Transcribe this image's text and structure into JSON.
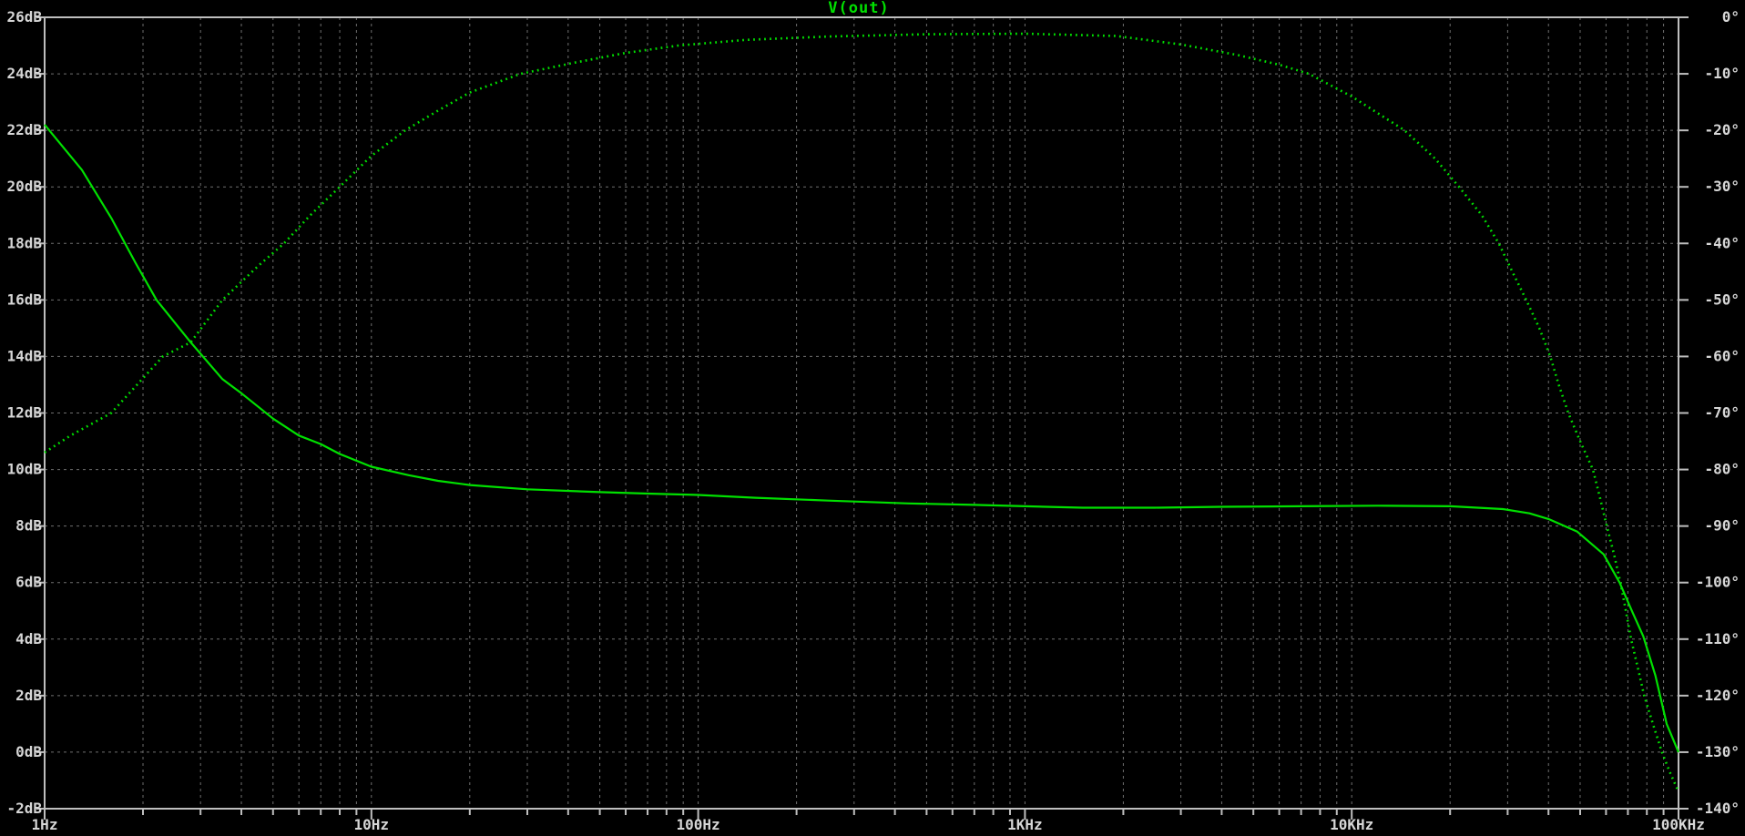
{
  "window": {
    "background": "#000000"
  },
  "chart_data": {
    "type": "line",
    "title": "V(out)",
    "title_color": "#00e000",
    "trace_color": "#00e000",
    "grid_color": "#6f6f6f",
    "axis_color": "#bebebe",
    "text_color": "#d6d6d6",
    "x_axis": {
      "scale": "log",
      "min_hz": 1,
      "max_hz": 100000,
      "tick_labels": [
        "1Hz",
        "10Hz",
        "100Hz",
        "1KHz",
        "10KHz",
        "100KHz"
      ]
    },
    "y_left_axis": {
      "unit": "dB",
      "max": 26,
      "min": -2,
      "step": 2,
      "tick_labels": [
        "26dB",
        "24dB",
        "22dB",
        "20dB",
        "18dB",
        "16dB",
        "14dB",
        "12dB",
        "10dB",
        "8dB",
        "6dB",
        "4dB",
        "2dB",
        "0dB",
        "-2dB"
      ]
    },
    "y_right_axis": {
      "unit": "deg",
      "max": 0,
      "min": -140,
      "step": 10,
      "tick_labels": [
        "0°",
        "-10°",
        "-20°",
        "-30°",
        "-40°",
        "-50°",
        "-60°",
        "-70°",
        "-80°",
        "-90°",
        "-100°",
        "-110°",
        "-120°",
        "-130°",
        "-140°"
      ]
    },
    "legend_position": "top-center-title-only",
    "grid": "on",
    "series": [
      {
        "name": "V(out) magnitude",
        "style": "solid",
        "axis": "left",
        "unit": "dB",
        "points": [
          [
            1,
            22.2
          ],
          [
            1.3,
            20.6
          ],
          [
            1.6,
            18.9
          ],
          [
            1.9,
            17.3
          ],
          [
            2.2,
            16.0
          ],
          [
            2.8,
            14.5
          ],
          [
            3.5,
            13.2
          ],
          [
            4,
            12.7
          ],
          [
            5,
            11.8
          ],
          [
            6,
            11.2
          ],
          [
            7,
            10.9
          ],
          [
            8,
            10.55
          ],
          [
            10,
            10.1
          ],
          [
            13,
            9.8
          ],
          [
            16,
            9.6
          ],
          [
            20,
            9.45
          ],
          [
            30,
            9.3
          ],
          [
            50,
            9.2
          ],
          [
            70,
            9.15
          ],
          [
            100,
            9.1
          ],
          [
            150,
            9.0
          ],
          [
            250,
            8.9
          ],
          [
            440,
            8.8
          ],
          [
            700,
            8.75
          ],
          [
            1000,
            8.7
          ],
          [
            1500,
            8.65
          ],
          [
            2500,
            8.65
          ],
          [
            4000,
            8.68
          ],
          [
            7000,
            8.7
          ],
          [
            12000,
            8.72
          ],
          [
            20000,
            8.7
          ],
          [
            29000,
            8.6
          ],
          [
            35000,
            8.45
          ],
          [
            40000,
            8.25
          ],
          [
            49000,
            7.8
          ],
          [
            59000,
            7.0
          ],
          [
            66000,
            6.0
          ],
          [
            72000,
            5.0
          ],
          [
            78000,
            4.1
          ],
          [
            85000,
            2.7
          ],
          [
            92000,
            1.0
          ],
          [
            100000,
            0.0
          ]
        ]
      },
      {
        "name": "V(out) phase",
        "style": "dotted",
        "axis": "right",
        "unit": "deg",
        "points": [
          [
            1,
            -77
          ],
          [
            1.2,
            -74
          ],
          [
            1.6,
            -70
          ],
          [
            2.3,
            -60
          ],
          [
            2.8,
            -57.5
          ],
          [
            3.5,
            -50
          ],
          [
            4.5,
            -44
          ],
          [
            5.4,
            -40
          ],
          [
            6.5,
            -35
          ],
          [
            8,
            -30
          ],
          [
            10,
            -24.5
          ],
          [
            12.7,
            -20
          ],
          [
            16,
            -16.5
          ],
          [
            20,
            -13.3
          ],
          [
            28.6,
            -10
          ],
          [
            42,
            -8
          ],
          [
            60,
            -6.3
          ],
          [
            87,
            -5
          ],
          [
            140,
            -4
          ],
          [
            250,
            -3.4
          ],
          [
            500,
            -3.0
          ],
          [
            1000,
            -2.9
          ],
          [
            1900,
            -3.3
          ],
          [
            3000,
            -4.8
          ],
          [
            4500,
            -6.7
          ],
          [
            6000,
            -8.4
          ],
          [
            7400,
            -10
          ],
          [
            10000,
            -14
          ],
          [
            14500,
            -20
          ],
          [
            18000,
            -25
          ],
          [
            21300,
            -30
          ],
          [
            25000,
            -35
          ],
          [
            28200,
            -40
          ],
          [
            31000,
            -45
          ],
          [
            34200,
            -50
          ],
          [
            37500,
            -55
          ],
          [
            40500,
            -60
          ],
          [
            43000,
            -65
          ],
          [
            46000,
            -70
          ],
          [
            50000,
            -75
          ],
          [
            54700,
            -80
          ],
          [
            57500,
            -85
          ],
          [
            60300,
            -90
          ],
          [
            63500,
            -95
          ],
          [
            66400,
            -100
          ],
          [
            69000,
            -105
          ],
          [
            71600,
            -110
          ],
          [
            75000,
            -115
          ],
          [
            78500,
            -120
          ],
          [
            83500,
            -125
          ],
          [
            89000,
            -130
          ],
          [
            94000,
            -133.5
          ],
          [
            100000,
            -137
          ]
        ]
      }
    ]
  }
}
